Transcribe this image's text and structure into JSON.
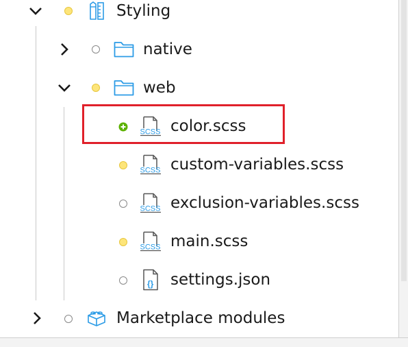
{
  "tree": {
    "items": [
      {
        "label": "Styling",
        "icon": "styling-ruler-icon",
        "status": "yellow",
        "expanded": true
      },
      {
        "label": "native",
        "icon": "folder-icon",
        "status": "gray",
        "expanded": false
      },
      {
        "label": "web",
        "icon": "folder-icon",
        "status": "yellow",
        "expanded": true
      },
      {
        "label": "color.scss",
        "icon": "scss-file-icon",
        "status": "green-added",
        "highlighted": true
      },
      {
        "label": "custom-variables.scss",
        "icon": "scss-file-icon",
        "status": "yellow"
      },
      {
        "label": "exclusion-variables.scss",
        "icon": "scss-file-icon",
        "status": "gray"
      },
      {
        "label": "main.scss",
        "icon": "scss-file-icon",
        "status": "yellow"
      },
      {
        "label": "settings.json",
        "icon": "json-file-icon",
        "status": "gray"
      },
      {
        "label": "Marketplace modules",
        "icon": "package-icon",
        "status": "gray",
        "expanded": false
      }
    ]
  },
  "icons": {
    "scss_badge": "SCSS",
    "json_badge": "{}"
  },
  "colors": {
    "folder": "#2b9be6",
    "status_yellow": "#fde57a",
    "status_green": "#5cb100",
    "highlight_border": "#e0202a"
  }
}
